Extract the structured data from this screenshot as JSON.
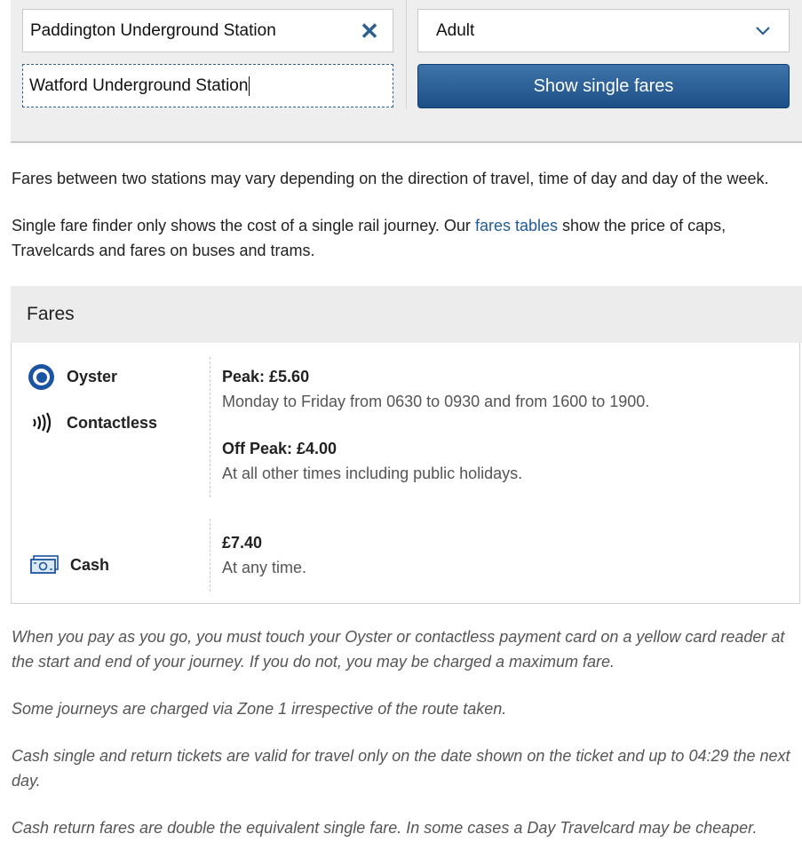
{
  "search": {
    "from_value": "Paddington Underground Station",
    "to_value": "Watford Underground Station",
    "passenger_type": "Adult",
    "submit_label": "Show single fares"
  },
  "info": {
    "line1": "Fares between two stations may vary depending on the direction of travel, time of day and day of the week.",
    "line2_before": "Single fare finder only shows the cost of a single rail journey. Our ",
    "line2_link": "fares tables",
    "line2_after": " show the price of caps, Travelcards and fares on buses and trams."
  },
  "fares": {
    "heading": "Fares",
    "payg_methods": [
      "Oyster",
      "Contactless"
    ],
    "peak_title": "Peak: £5.60",
    "peak_desc": "Monday to Friday from 0630 to 0930 and from 1600 to 1900.",
    "offpeak_title": "Off Peak: £4.00",
    "offpeak_desc": "At all other times including public holidays.",
    "cash_label": "Cash",
    "cash_title": "£7.40",
    "cash_desc": "At any time."
  },
  "notes": [
    "When you pay as you go, you must touch your Oyster or contactless payment card on a yellow card reader at the start and end of your journey. If you do not, you may be charged a maximum fare.",
    "Some journeys are charged via Zone 1 irrespective of the route taken.",
    "Cash single and return tickets are valid for travel only on the date shown on the ticket and up to 04:29 the next day.",
    "Cash return fares are double the equivalent single fare. In some cases a Day Travelcard may be cheaper."
  ],
  "colors": {
    "accent": "#1f5b94",
    "button": "#2b5f94",
    "oyster_blue": "#1a54a3"
  },
  "icons": [
    "clear-icon",
    "chevron-down-icon",
    "oyster-icon",
    "contactless-icon",
    "cash-icon"
  ]
}
